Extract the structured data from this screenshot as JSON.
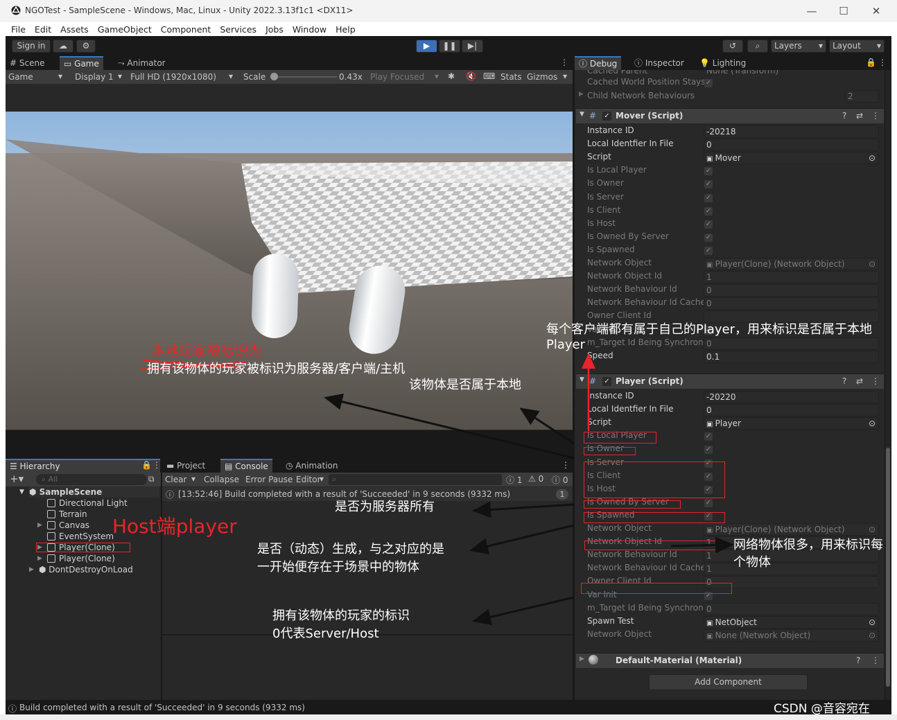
{
  "window": {
    "title": "NGOTest - SampleScene - Windows, Mac, Linux - Unity 2022.3.13f1c1 <DX11>",
    "minimize": "—",
    "maximize": "☐",
    "close": "✕"
  },
  "menu": [
    "File",
    "Edit",
    "Assets",
    "GameObject",
    "Component",
    "Services",
    "Jobs",
    "Window",
    "Help"
  ],
  "toolbar": {
    "sign_in": "Sign in",
    "layers": "Layers",
    "layout": "Layout"
  },
  "scene_tabs": [
    "Scene",
    "Game",
    "Animator"
  ],
  "game_bar": {
    "mode": "Game",
    "display": "Display 1",
    "resolution": "Full HD (1920x1080)",
    "scale_label": "Scale",
    "scale_value": "0.43x",
    "play_focused": "Play Focused",
    "stats": "Stats",
    "gizmos": "Gizmos"
  },
  "inspector_tabs": [
    "Debug",
    "Inspector",
    "Lighting"
  ],
  "inspector_top": {
    "cached_parent": "Cached Parent",
    "cached_parent_value": "None (Transform)",
    "cached_world_position_stays": "Cached World Position Stays",
    "child_network_behaviours": "Child Network Behaviours",
    "child_count": "2"
  },
  "mover": {
    "title": "Mover (Script)",
    "rows": [
      {
        "label": "Instance ID",
        "value": "-20218",
        "kind": "field"
      },
      {
        "label": "Local Identfier In File",
        "value": "0",
        "kind": "field"
      },
      {
        "label": "Script",
        "value": "Mover",
        "kind": "object"
      },
      {
        "label": "Is Local Player",
        "kind": "check"
      },
      {
        "label": "Is Owner",
        "kind": "check"
      },
      {
        "label": "Is Server",
        "kind": "check"
      },
      {
        "label": "Is Client",
        "kind": "check"
      },
      {
        "label": "Is Host",
        "kind": "check"
      },
      {
        "label": "Is Owned By Server",
        "kind": "check"
      },
      {
        "label": "Is Spawned",
        "kind": "check"
      },
      {
        "label": "Network Object",
        "value": "Player(Clone) (Network Object)",
        "kind": "object"
      },
      {
        "label": "Network Object Id",
        "value": "1",
        "kind": "field"
      },
      {
        "label": "Network Behaviour Id",
        "value": "0",
        "kind": "field"
      },
      {
        "label": "Network Behaviour Id Cache",
        "value": "0",
        "kind": "field"
      },
      {
        "label": "Owner Client Id",
        "value": "",
        "kind": "field"
      },
      {
        "label": "Var Init",
        "kind": "check"
      },
      {
        "label": "m_Target Id Being Synchroniz",
        "value": "0",
        "kind": "field"
      },
      {
        "label": "Speed",
        "value": "0.1",
        "kind": "field"
      }
    ]
  },
  "player": {
    "title": "Player (Script)",
    "rows": [
      {
        "label": "Instance ID",
        "value": "-20220",
        "kind": "field"
      },
      {
        "label": "Local Identfier In File",
        "value": "0",
        "kind": "field"
      },
      {
        "label": "Script",
        "value": "Player",
        "kind": "object"
      },
      {
        "label": "Is Local Player",
        "kind": "check"
      },
      {
        "label": "Is Owner",
        "kind": "check"
      },
      {
        "label": "Is Server",
        "kind": "check"
      },
      {
        "label": "Is Client",
        "kind": "check"
      },
      {
        "label": "Is Host",
        "kind": "check"
      },
      {
        "label": "Is Owned By Server",
        "kind": "check"
      },
      {
        "label": "Is Spawned",
        "kind": "check"
      },
      {
        "label": "Network Object",
        "value": "Player(Clone) (Network Object)",
        "kind": "object"
      },
      {
        "label": "Network Object Id",
        "value": "1",
        "kind": "field"
      },
      {
        "label": "Network Behaviour Id",
        "value": "1",
        "kind": "field"
      },
      {
        "label": "Network Behaviour Id Cache",
        "value": "1",
        "kind": "field"
      },
      {
        "label": "Owner Client Id",
        "value": "0",
        "kind": "field"
      },
      {
        "label": "Var Init",
        "kind": "check"
      },
      {
        "label": "m_Target Id Being Synchroniz",
        "value": "0",
        "kind": "field"
      },
      {
        "label": "Spawn Test",
        "value": "NetObject",
        "kind": "object"
      },
      {
        "label": "Network Object",
        "value": "None (Network Object)",
        "kind": "object"
      }
    ]
  },
  "material": {
    "title": "Default-Material (Material)"
  },
  "add_component": "Add Component",
  "hierarchy": {
    "tab": "Hierarchy",
    "search_placeholder": "All",
    "items": [
      {
        "label": "SampleScene",
        "depth": 0
      },
      {
        "label": "Directional Light",
        "depth": 1
      },
      {
        "label": "Terrain",
        "depth": 1
      },
      {
        "label": "Canvas",
        "depth": 1
      },
      {
        "label": "EventSystem",
        "depth": 1
      },
      {
        "label": "Player(Clone)",
        "depth": 1
      },
      {
        "label": "Player(Clone)",
        "depth": 1
      },
      {
        "label": "DontDestroyOnLoad",
        "depth": 0
      }
    ]
  },
  "bottom_tabs": [
    "Project",
    "Console",
    "Animation"
  ],
  "console": {
    "clear": "Clear",
    "collapse": "Collapse",
    "error_pause": "Error Pause",
    "editor": "Editor",
    "count_info": "1",
    "count_warn": "0",
    "count_error": "0",
    "message": "[13:52:46] Build completed with a result of 'Succeeded' in 9 seconds (9332 ms)",
    "message_count": "1"
  },
  "status_bar": "Build completed with a result of 'Succeeded' in 9 seconds (9332 ms)",
  "annotations": {
    "local_player_red": "本地玩家被标识为",
    "struck_line": "拥有该物体的玩家被标识为服务器/客户端/主机",
    "belongs_local": "该物体是否属于本地",
    "each_client": "每个客户端都有属于自己的Player，用来标识是否属于本地",
    "each_client_2": "Player",
    "host_player": "Host端player",
    "owned_server": "是否为服务器所有",
    "spawned_1": "是否（动态）生成，与之对应的是",
    "spawned_2": "一开始便存在于场景中的物体",
    "netobj_1": "网络物体很多，用来标识每",
    "netobj_2": "个物体",
    "owner_1": "拥有该物体的玩家的标识",
    "owner_2": "0代表Server/Host",
    "watermark": "CSDN @音容宛在"
  }
}
